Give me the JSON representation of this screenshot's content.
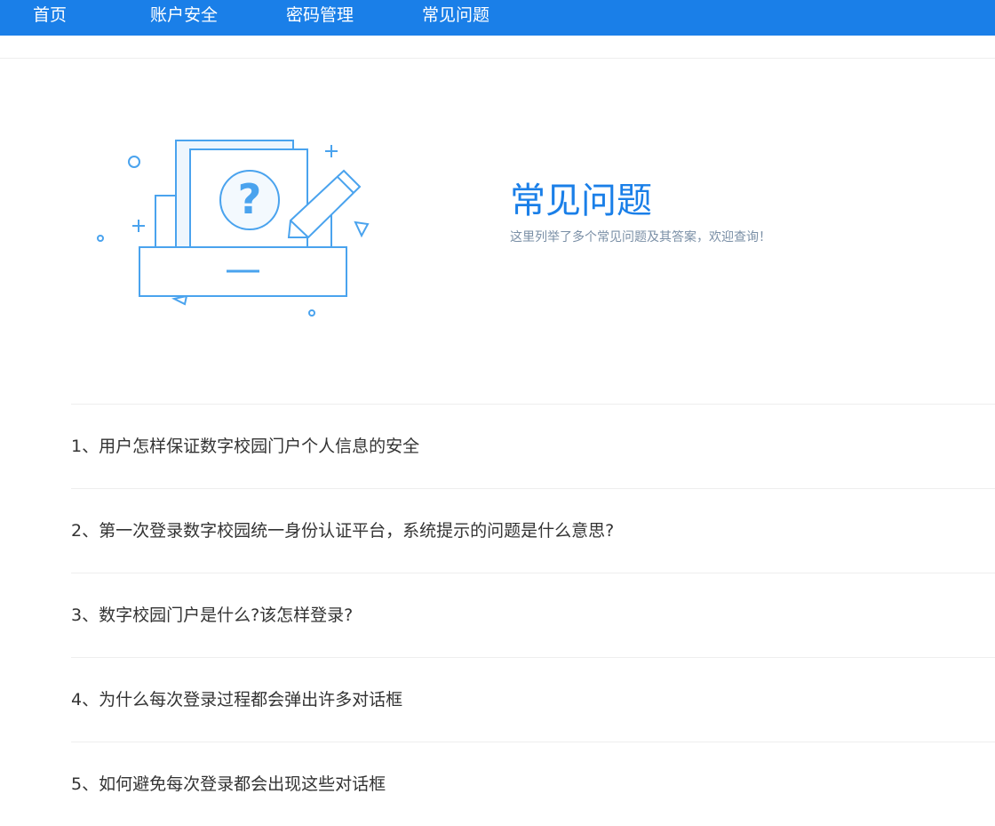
{
  "nav": {
    "items": [
      {
        "label": "首页"
      },
      {
        "label": "账户安全"
      },
      {
        "label": "密码管理"
      },
      {
        "label": "常见问题"
      }
    ]
  },
  "hero": {
    "title": "常见问题",
    "subtitle": "这里列举了多个常见问题及其答案，欢迎查询！",
    "illustration_icon": "question-document-icon"
  },
  "faq": {
    "items": [
      {
        "text": "1、用户怎样保证数字校园门户个人信息的安全"
      },
      {
        "text": "2、第一次登录数字校园统一身份认证平台，系统提示的问题是什么意思?"
      },
      {
        "text": "3、数字校园门户是什么?该怎样登录?"
      },
      {
        "text": "4、为什么每次登录过程都会弹出许多对话框"
      },
      {
        "text": "5、如何避免每次登录都会出现这些对话框"
      }
    ]
  },
  "colors": {
    "accent": "#1a7fe8",
    "illustration_stroke": "#4aa3ee",
    "subtitle": "#7a8fa6",
    "text": "#333333"
  }
}
